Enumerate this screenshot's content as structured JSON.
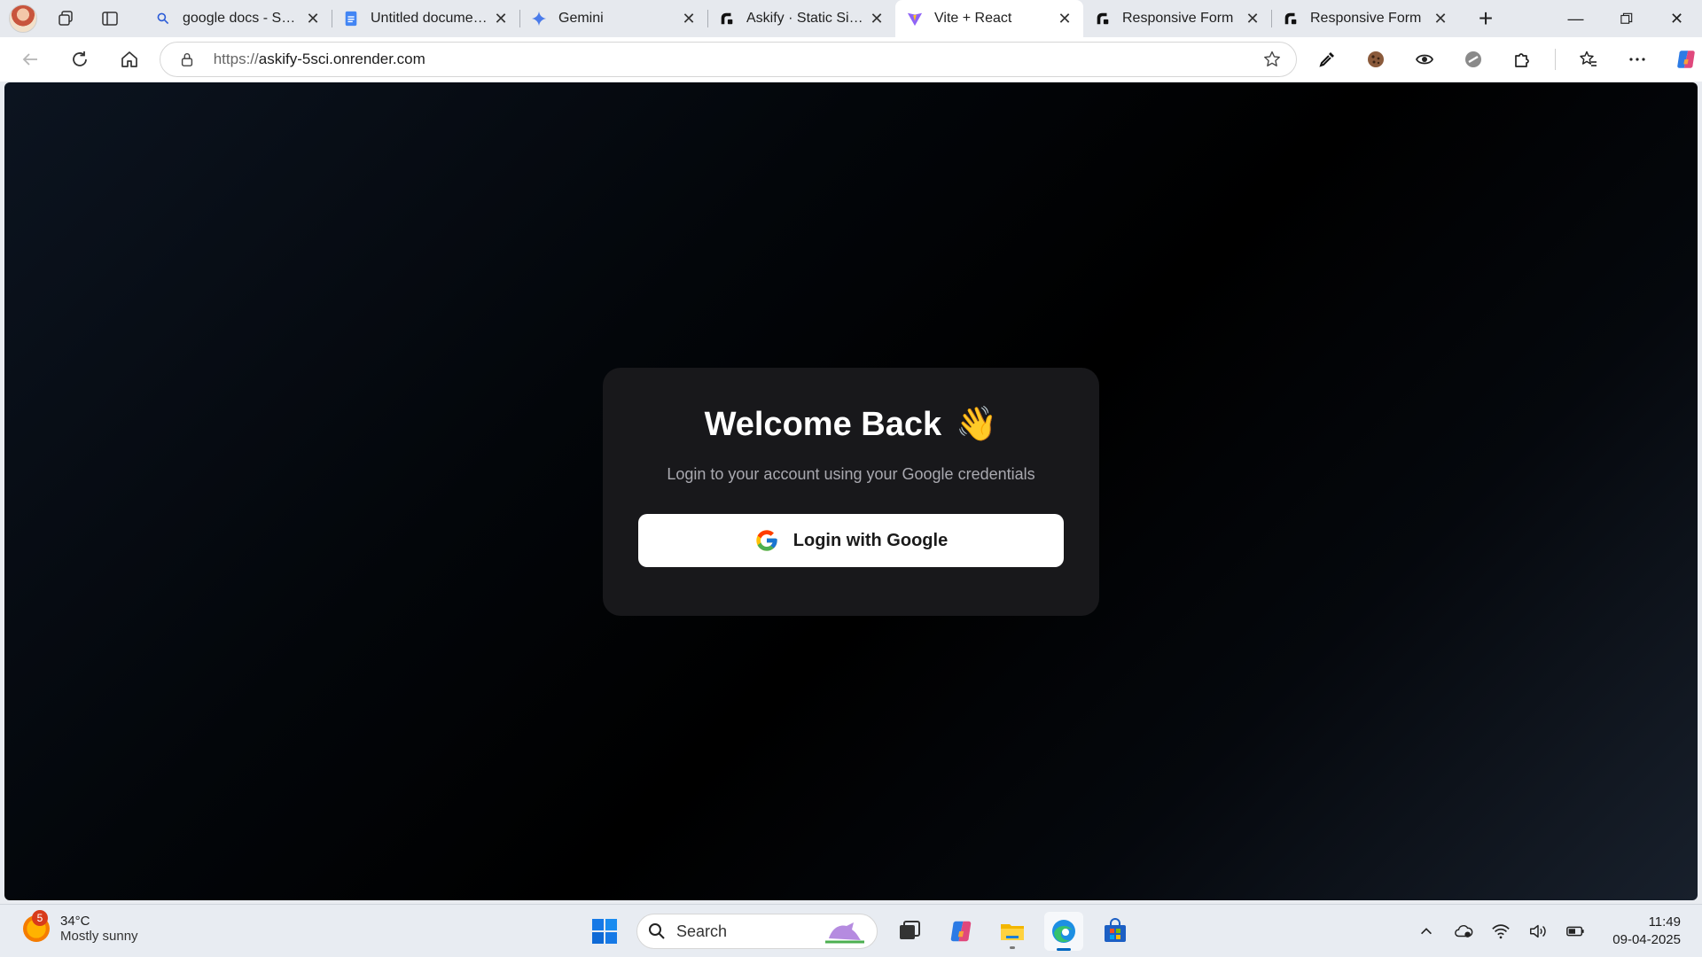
{
  "browser": {
    "tabs": [
      {
        "title": "google docs - Search",
        "icon": "search-icon"
      },
      {
        "title": "Untitled document - Google Docs",
        "icon": "docs-icon"
      },
      {
        "title": "Gemini",
        "icon": "gemini-icon"
      },
      {
        "title": "Askify · Static Site · Render",
        "icon": "render-icon"
      },
      {
        "title": "Vite + React",
        "icon": "vite-icon",
        "active": true
      },
      {
        "title": "Responsive Form",
        "icon": "render-icon"
      },
      {
        "title": "Responsive Form",
        "icon": "render-icon"
      }
    ],
    "address": {
      "scheme": "https://",
      "host": "askify-5sci.onrender.com"
    }
  },
  "login": {
    "title": "Welcome Back",
    "emoji": "👋",
    "subtitle": "Login to your account using your Google credentials",
    "button_label": "Login with Google"
  },
  "taskbar": {
    "weather": {
      "badge": "5",
      "temp": "34°C",
      "condition": "Mostly sunny"
    },
    "search_placeholder": "Search",
    "time": "11:49",
    "date": "09-04-2025"
  },
  "colors": {
    "card_bg": "#18181b",
    "button_bg": "#ffffff",
    "page_bg": "#000000"
  }
}
